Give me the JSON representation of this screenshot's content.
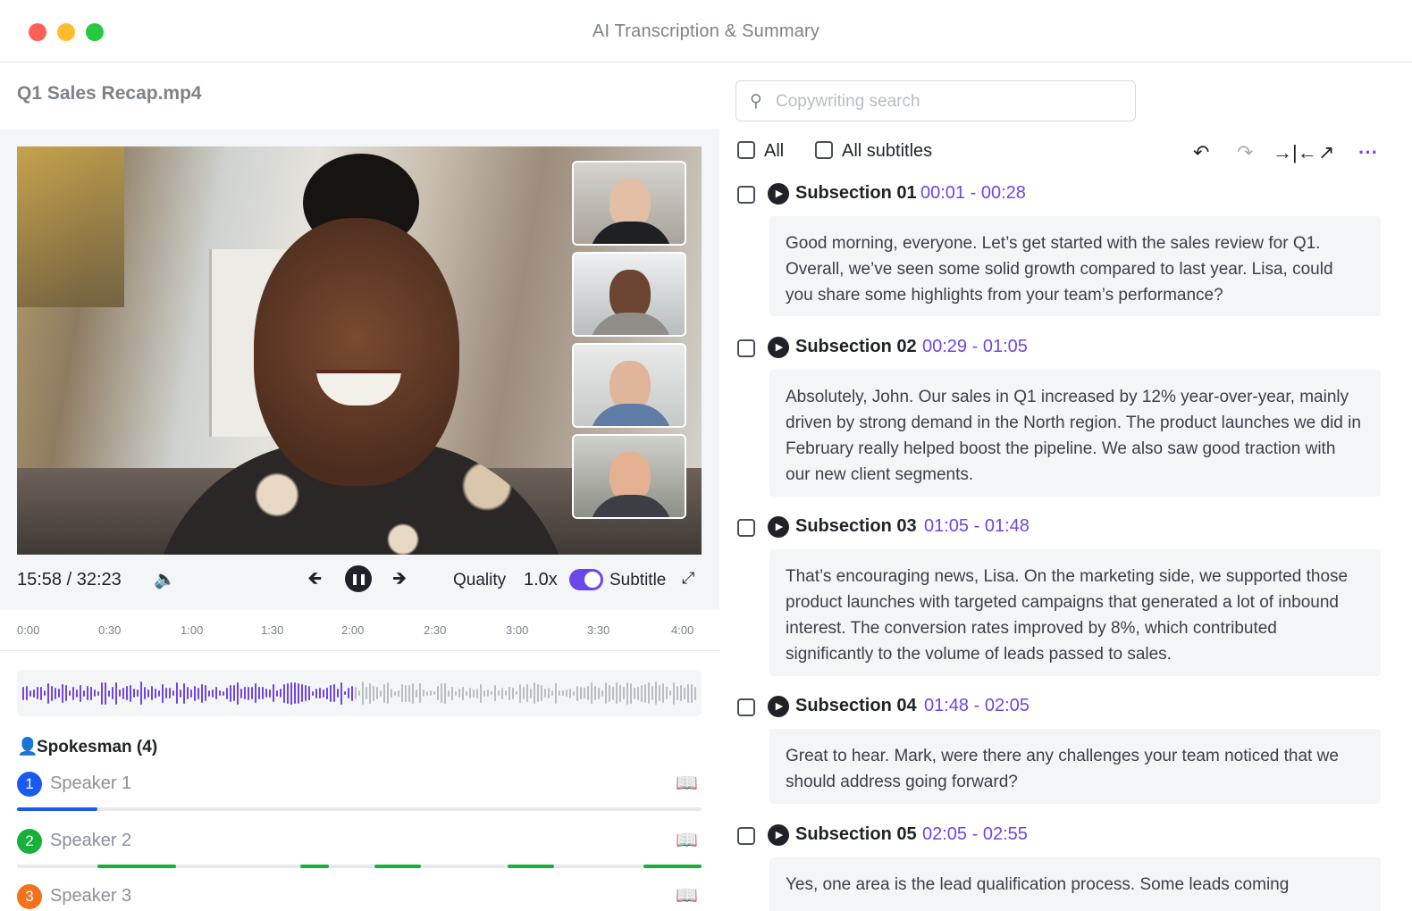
{
  "window": {
    "title": "AI Transcription & Summary"
  },
  "file": {
    "name": "Q1 Sales Recap.mp4"
  },
  "player": {
    "time": "15:58 / 32:23",
    "quality_label": "Quality",
    "speed": "1.0x",
    "subtitle_label": "Subtitle",
    "subtitle_on": true
  },
  "timeline": {
    "ticks": [
      "0:00",
      "0:30",
      "1:00",
      "1:30",
      "2:00",
      "2:30",
      "3:00",
      "3:30",
      "4:00"
    ]
  },
  "waveform": {
    "played_color": "#7045e6",
    "unplayed_color": "#b8bcc3"
  },
  "speakers": {
    "heading": "Spokesman (4)",
    "items": [
      {
        "number": "1",
        "name": "Speaker 1",
        "color": "#1a5af0"
      },
      {
        "number": "2",
        "name": "Speaker 2",
        "color": "#16b13a"
      },
      {
        "number": "3",
        "name": "Speaker 3",
        "color": "#f2711c"
      }
    ]
  },
  "search": {
    "placeholder": "Copywriting search"
  },
  "filters": {
    "all": "All",
    "all_subtitles": "All subtitles"
  },
  "toolbar_icons": [
    "undo-icon",
    "redo-icon",
    "merge-icon",
    "export-icon",
    "more-icon"
  ],
  "accent_color": "#7045e6",
  "subsections": [
    {
      "title": "Subsection 01",
      "range": "00:01 - 00:28",
      "text": "Good morning, everyone. Let’s get started with the sales review for Q1. Overall, we’ve seen some solid growth compared to last year. Lisa, could you share some highlights from your team’s performance?"
    },
    {
      "title": "Subsection 02",
      "range": "00:29 - 01:05",
      "text": "Absolutely, John. Our sales in Q1 increased by 12% year-over-year, mainly driven by strong demand in the North region. The product launches we did in February really helped boost the pipeline. We also saw good traction with our new client segments."
    },
    {
      "title": "Subsection 03",
      "range": "01:05 - 01:48",
      "text": "That’s encouraging news, Lisa. On the marketing side, we supported those product launches with targeted campaigns that generated a lot of inbound interest. The conversion rates improved by 8%, which contributed significantly to the volume of leads passed to sales."
    },
    {
      "title": "Subsection 04",
      "range": "01:48 - 02:05",
      "text": "Great to hear. Mark, were there any challenges your team noticed that we should address going forward?"
    },
    {
      "title": "Subsection 05",
      "range": "02:05 - 02:55",
      "text": "Yes, one area is the lead qualification process. Some leads coming"
    }
  ]
}
